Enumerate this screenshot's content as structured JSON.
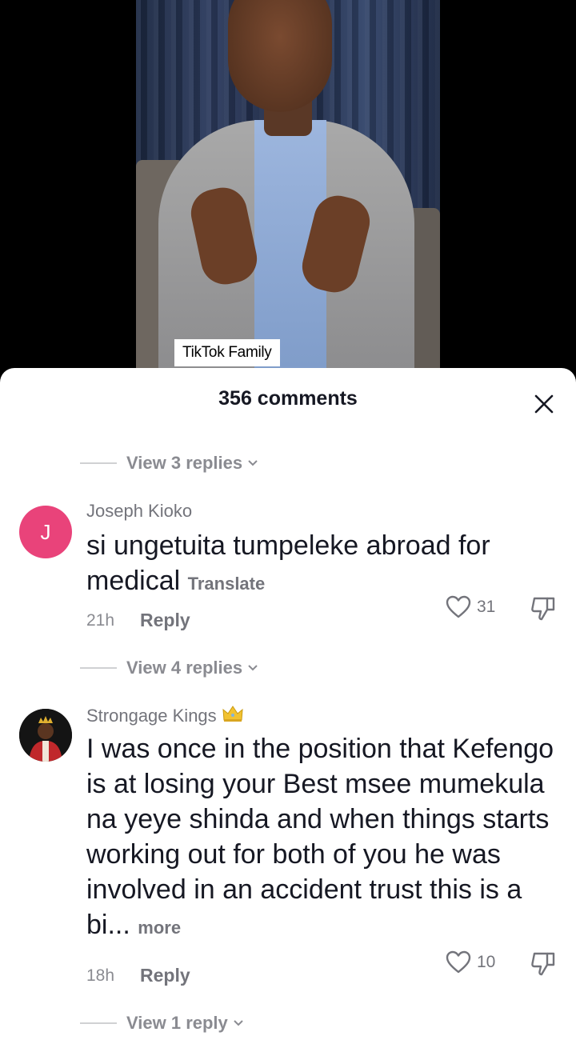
{
  "video": {
    "tag_label": "TikTok Family"
  },
  "sheet": {
    "title": "356 comments"
  },
  "threads": {
    "before_first": {
      "view_replies": "View 3 replies"
    },
    "comment1": {
      "avatar_letter": "J",
      "username": "Joseph Kioko",
      "text": "si ungetuita tumpeleke abroad for medical",
      "translate": "Translate",
      "time": "21h",
      "reply": "Reply",
      "likes": "31",
      "view_replies": "View 4 replies"
    },
    "comment2": {
      "username": "Strongage Kings",
      "badge": "crown-emoji",
      "text": "I was once in the position that Kefengo is at losing your Best msee mumekula na yeye shinda and when things starts working out for both of you he was involved in an accident trust this is a bi...",
      "more": "more",
      "time": "18h",
      "reply": "Reply",
      "likes": "10",
      "view_replies": "View 1 reply"
    }
  },
  "colors": {
    "avatar_j": "#e9437a",
    "muted_text": "#73747b",
    "primary_text": "#161823"
  }
}
